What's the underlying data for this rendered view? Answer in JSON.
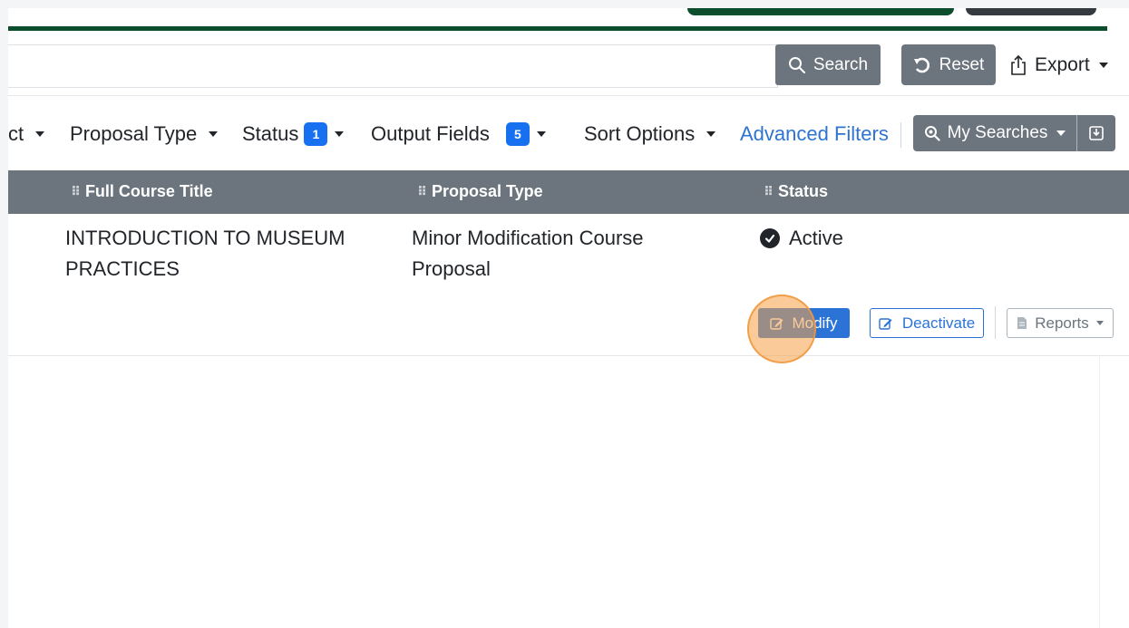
{
  "colors": {
    "brand_green": "#0b4d2c",
    "secondary_button": "#6c757d",
    "primary_blue": "#2b73d6",
    "badge_blue": "#1670f0",
    "link_blue": "#2f74d0",
    "click_highlight": "#f5a046"
  },
  "search_bar": {
    "query": "",
    "search_label": "Search",
    "reset_label": "Reset",
    "export_label": "Export"
  },
  "filters": {
    "partial_label": "ct",
    "proposal_type": "Proposal Type",
    "status": "Status",
    "status_count": "1",
    "output_fields": "Output Fields",
    "output_fields_count": "5",
    "sort_options": "Sort Options",
    "advanced_filters": "Advanced Filters",
    "my_searches": "My Searches"
  },
  "table": {
    "headers": [
      "Full Course Title",
      "Proposal Type",
      "Status"
    ],
    "rows": [
      {
        "title": "INTRODUCTION TO MUSEUM PRACTICES",
        "proposal_type": "Minor Modification Course Proposal",
        "status": "Active",
        "actions": {
          "modify": "Modify",
          "deactivate": "Deactivate",
          "reports": "Reports"
        }
      }
    ]
  },
  "icons": [
    "search-icon",
    "reset-icon",
    "export-icon",
    "magnifier-icon",
    "save-search-icon",
    "check-circle-icon",
    "edit-icon",
    "document-icon",
    "drag-handle-icon",
    "caret-down-icon"
  ]
}
